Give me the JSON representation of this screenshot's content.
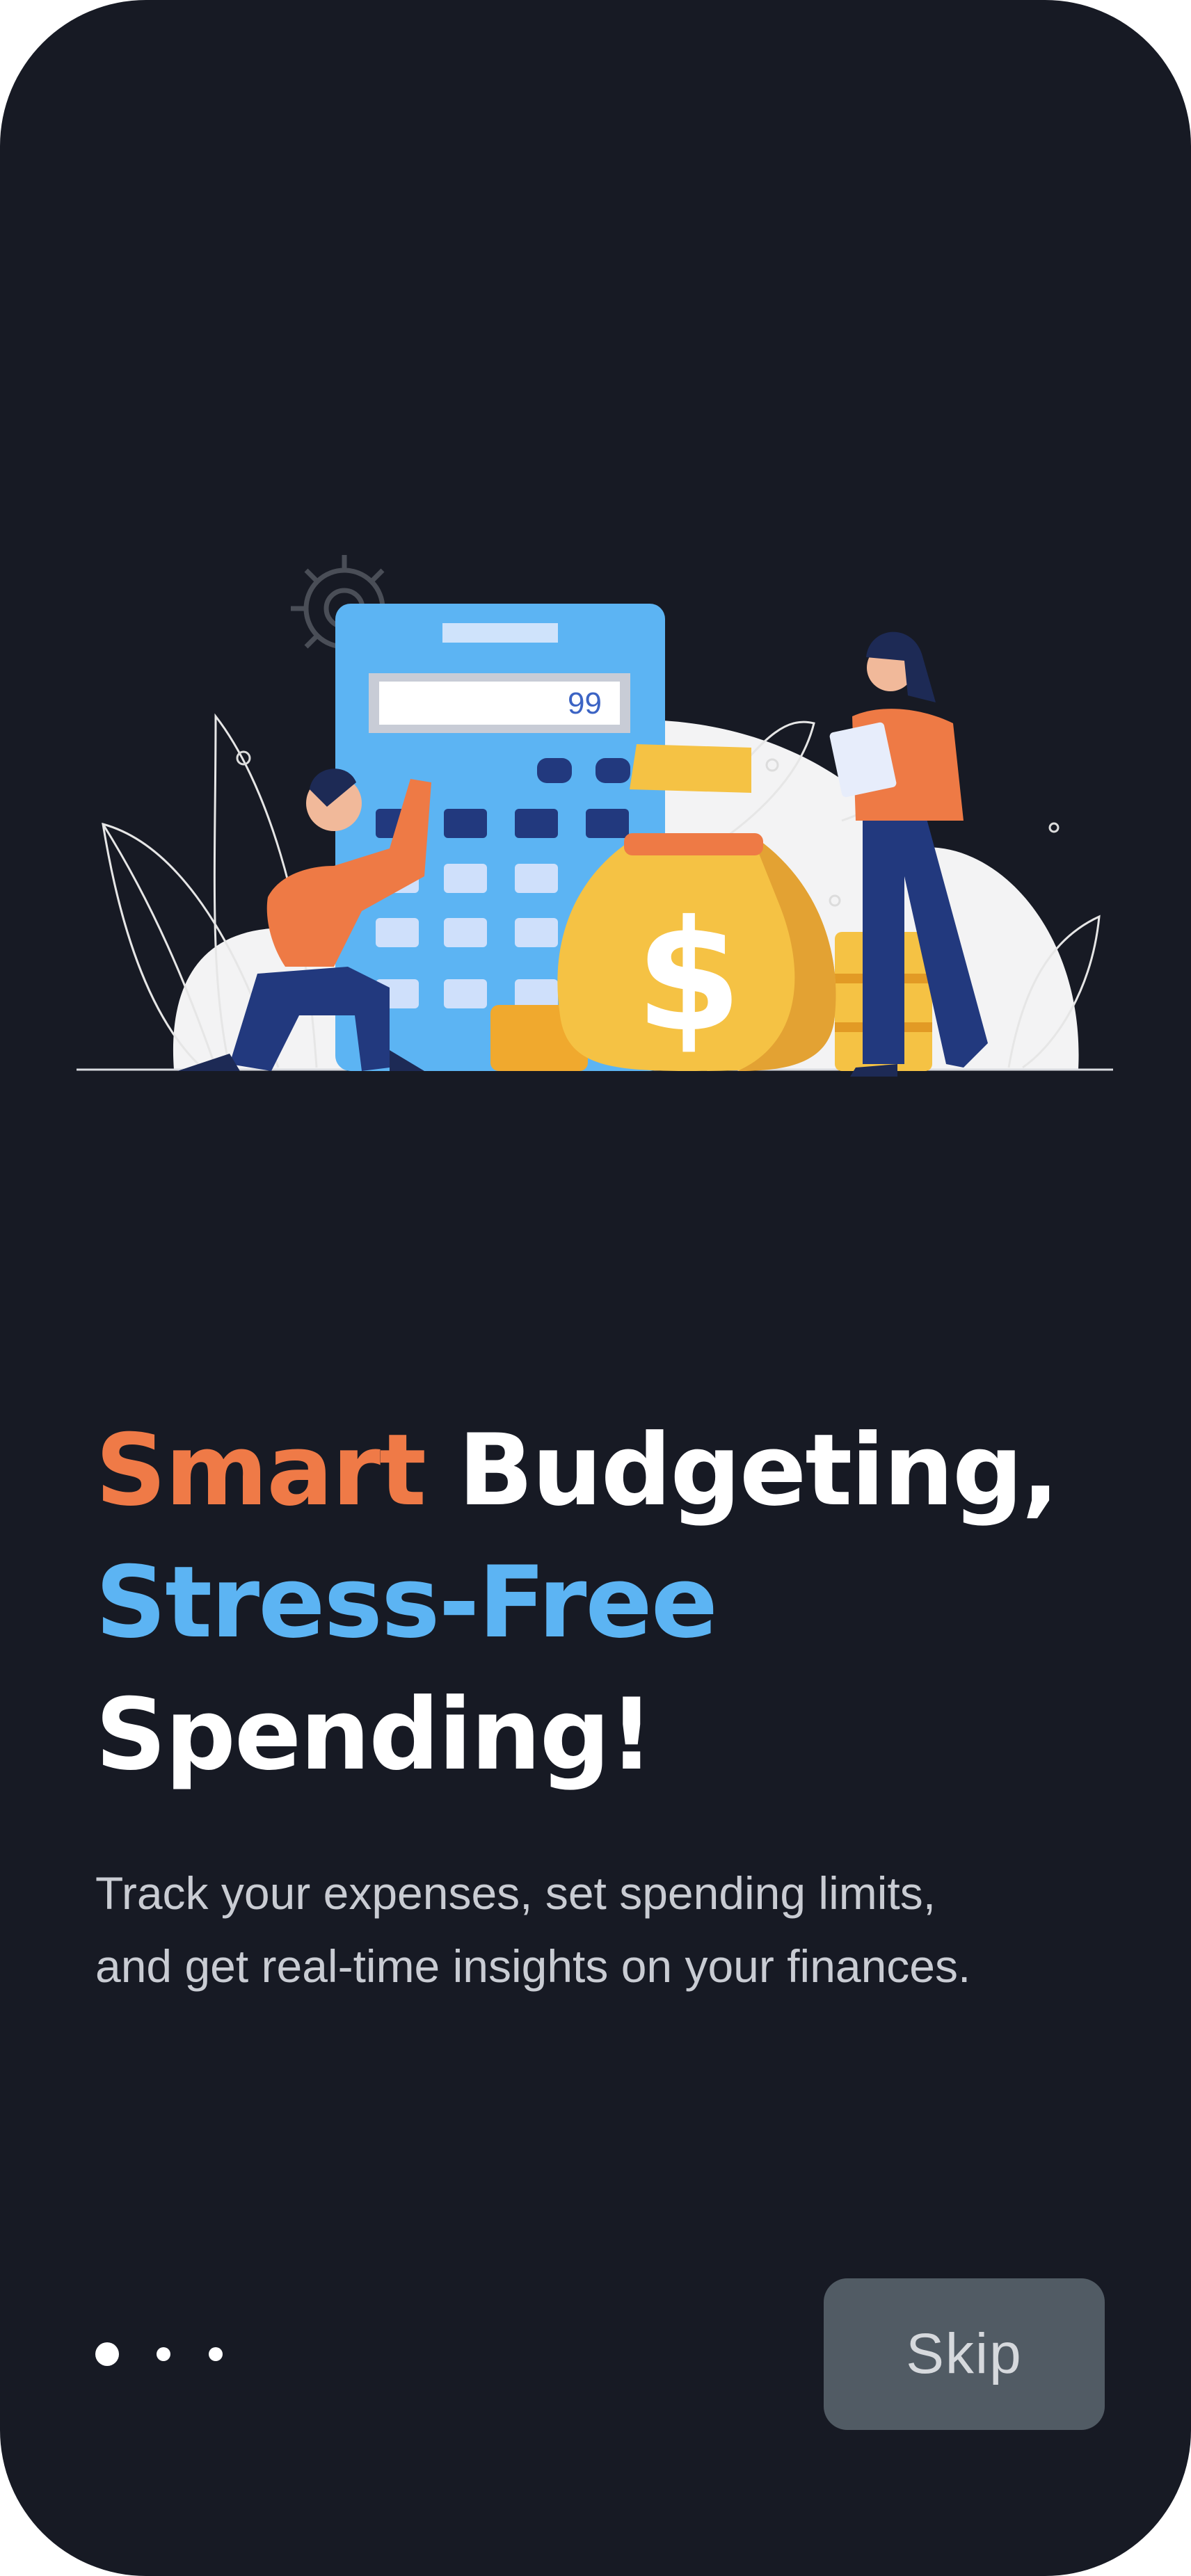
{
  "screen": {
    "background_color": "#171a24",
    "accent_orange": "#ef7a47",
    "accent_blue": "#5cb4f3"
  },
  "illustration": {
    "icon": "budgeting-illustration",
    "calculator_display": "99",
    "money_bag_symbol": "$"
  },
  "headline": {
    "part1": "Smart",
    "part2": "Budgeting,",
    "part3": "Stress-Free",
    "part4": "Spending!"
  },
  "subtitle": {
    "line1": "Track your expenses, set spending limits,",
    "line2": "and get real-time insights on your finances."
  },
  "pagination": {
    "total_pages": 3,
    "current_page": 1
  },
  "skip_button": {
    "label": "Skip"
  }
}
